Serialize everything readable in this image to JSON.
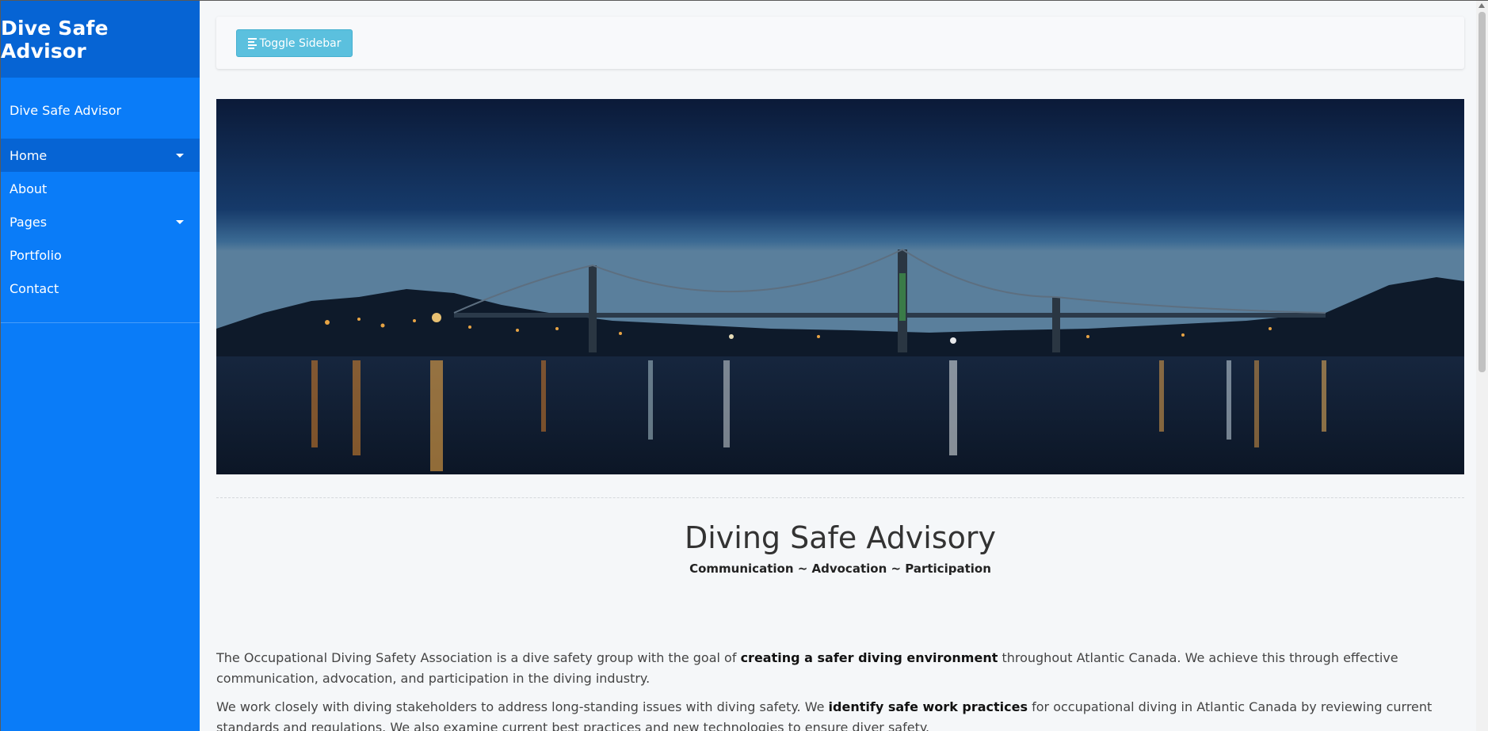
{
  "sidebar": {
    "title": "Dive Safe Advisor",
    "subtitle": "Dive Safe Advisor",
    "items": [
      {
        "label": "Home",
        "has_caret": true,
        "active": true
      },
      {
        "label": "About",
        "has_caret": false
      },
      {
        "label": "Pages",
        "has_caret": true
      },
      {
        "label": "Portfolio",
        "has_caret": false
      },
      {
        "label": "Contact",
        "has_caret": false
      }
    ]
  },
  "topbar": {
    "toggle_label": "Toggle Sidebar",
    "toggle_icon": "align-left-icon"
  },
  "hero": {
    "image": "harbour-bridge-night-icon"
  },
  "content": {
    "heading": "Diving Safe Advisory",
    "tagline": "Communication ~ Advocation ~ Participation",
    "p1_a": "The Occupational Diving Safety Association is a dive safety group with the goal of ",
    "p1_b": "creating a safer diving environment",
    "p1_c": " throughout Atlantic Canada. We achieve this through effective communication, advocation, and participation in the diving industry.",
    "p2_a": "We work closely with diving stakeholders to address long-standing issues with diving safety. We ",
    "p2_b": "identify safe work practices",
    "p2_c": " for occupational diving in Atlantic Canada by reviewing current standards and regulations. We also examine current best practices and new technologies to ensure diver safety."
  },
  "colors": {
    "sidebar": "#0a7cf8",
    "sidebar_header": "#0664d4",
    "toggle_button": "#5bc0de",
    "background": "#f5f7f9"
  }
}
